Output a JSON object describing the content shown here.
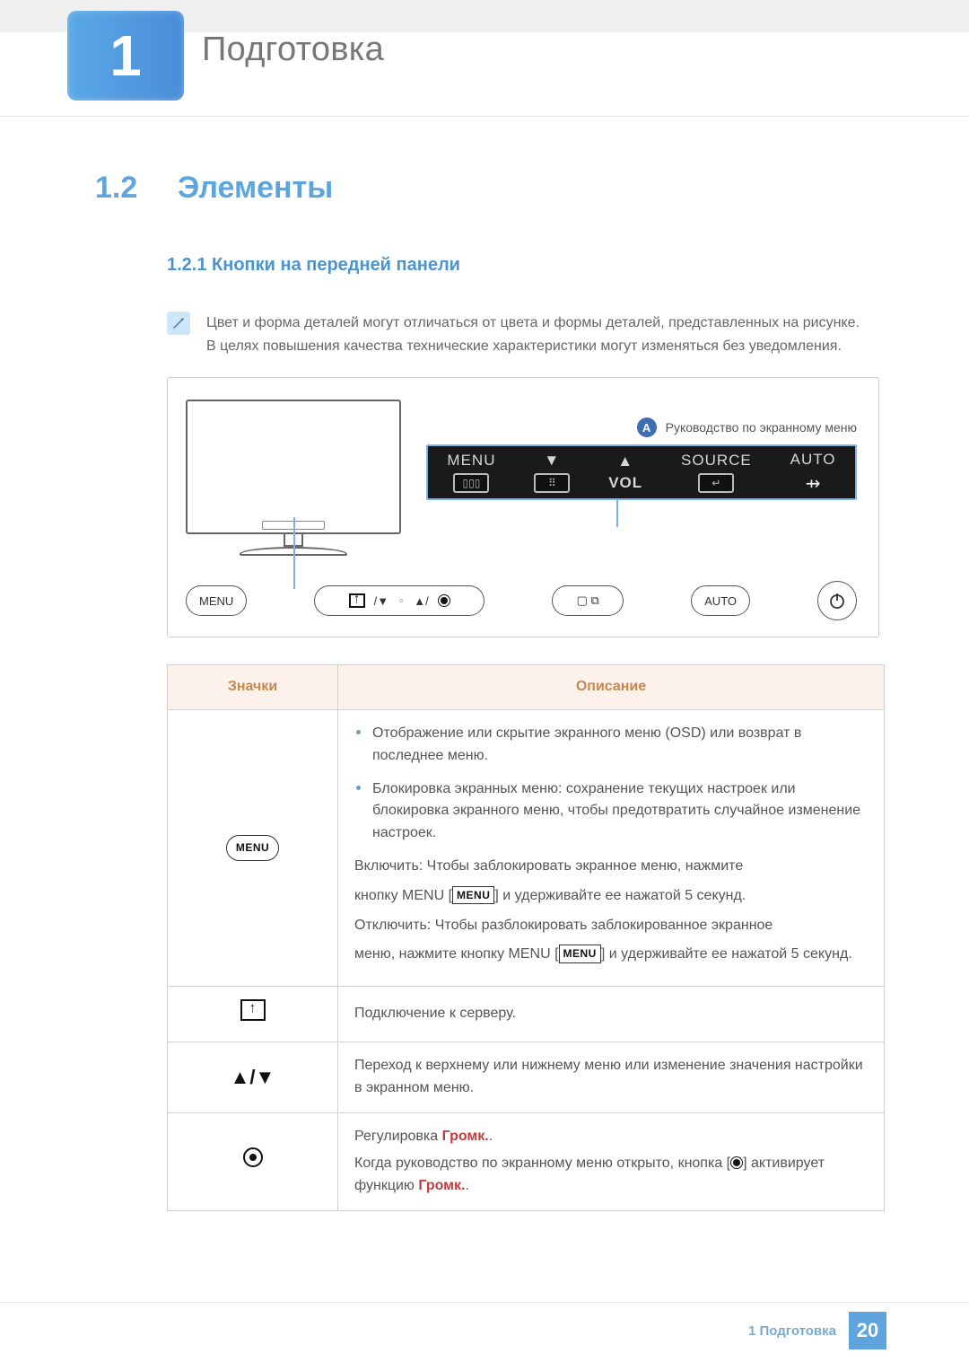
{
  "chapter": {
    "number": "1",
    "title": "Подготовка"
  },
  "section": {
    "number": "1.2",
    "title": "Элементы"
  },
  "subsection": {
    "number_title": "1.2.1  Кнопки на передней панели"
  },
  "note": {
    "line1": "Цвет и форма деталей могут отличаться от цвета и формы деталей, представленных на рисунке.",
    "line2": "В целях повышения качества технические характеристики могут изменяться без уведомления."
  },
  "figure": {
    "callout_letter": "A",
    "callout_text": "Руководство по экранному меню",
    "osd": {
      "menu": "MENU",
      "down": "▼",
      "up": "▲",
      "vol": "VOL",
      "source": "SOURCE",
      "auto": "AUTO"
    },
    "buttons": {
      "menu": "MENU",
      "auto_small": "AUTO"
    }
  },
  "table": {
    "head_icons": "Значки",
    "head_desc": "Описание",
    "rows": {
      "r1": {
        "icon_label": "MENU",
        "b1": "Отображение или скрытие экранного меню (OSD) или возврат в последнее меню.",
        "b2": "Блокировка экранных меню: сохранение текущих настроек или блокировка экранного меню, чтобы предотвратить случайное изменение настроек.",
        "p1a": "Включить: Чтобы заблокировать экранное меню, нажмите",
        "p1b_a": "кнопку MENU [",
        "p1b_b": "] и удерживайте ее нажатой 5 секунд.",
        "p2": "Отключить: Чтобы разблокировать заблокированное экранное",
        "p3a": "меню, нажмите кнопку MENU [",
        "p3b": "] и удерживайте ее нажатой 5 секунд.",
        "menu_inline": "MENU"
      },
      "r2": {
        "desc": "Подключение к серверу."
      },
      "r3": {
        "desc": "Переход к верхнему или нижнему меню или изменение значения настройки в экранном меню."
      },
      "r4": {
        "line1_a": "Регулировка ",
        "vol": "Громк.",
        "period": ".",
        "line2_a": "Когда руководство по экранному меню открыто, кнопка [",
        "line2_b": "] активирует функцию ",
        "vol2": "Громк.",
        "period2": "."
      }
    }
  },
  "footer": {
    "label": "1 Подготовка",
    "page": "20"
  }
}
